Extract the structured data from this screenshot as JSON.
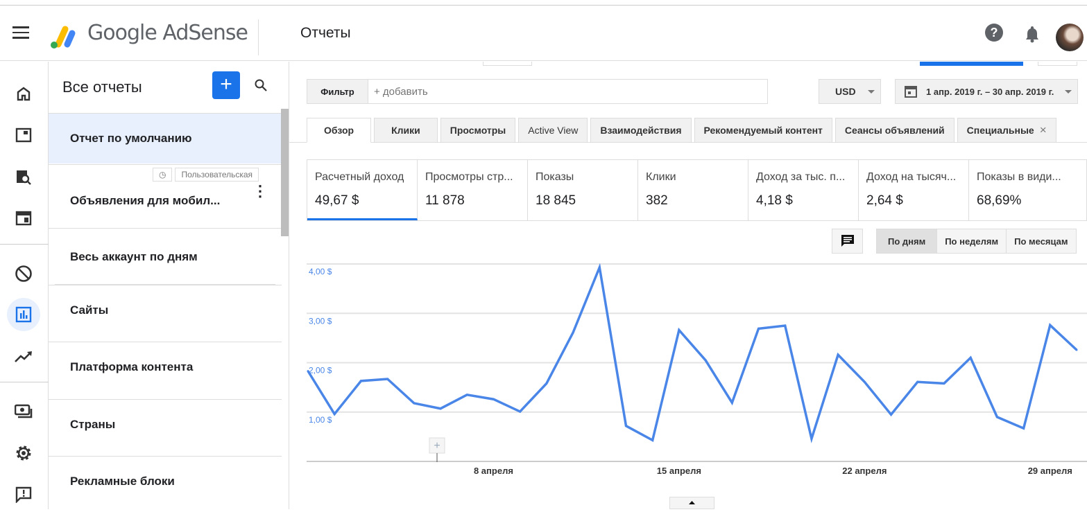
{
  "header": {
    "brand": "Google AdSense",
    "title": "Отчеты",
    "help_icon": "?"
  },
  "leftnav": {
    "items": [
      "home",
      "ads",
      "page-preview",
      "ad-units",
      "block-controls",
      "reports",
      "optimization",
      "payments",
      "settings",
      "feedback"
    ],
    "active": "reports"
  },
  "reports_panel": {
    "title": "Все отчеты",
    "add_label": "+",
    "items": [
      {
        "label": "Отчет по умолчанию",
        "selected": true
      },
      {
        "label": "Объявления для мобил...",
        "tag": "Пользовательская"
      },
      {
        "label": "Весь аккаунт по дням"
      },
      {
        "label": "Сайты"
      },
      {
        "label": "Платформа контента"
      },
      {
        "label": "Страны"
      },
      {
        "label": "Рекламные блоки"
      }
    ]
  },
  "toolbar": {
    "filter_label": "Фильтр",
    "filter_placeholder": "+ добавить",
    "currency": "USD",
    "date_range": "1 апр. 2019 г. – 30 апр. 2019 г."
  },
  "tabs": [
    {
      "label": "Обзор",
      "active": true
    },
    {
      "label": "Клики"
    },
    {
      "label": "Просмотры"
    },
    {
      "label": "Active View"
    },
    {
      "label": "Взаимодействия"
    },
    {
      "label": "Рекомендуемый контент"
    },
    {
      "label": "Сеансы объявлений"
    },
    {
      "label": "Специальные",
      "closable": true,
      "close": "×"
    }
  ],
  "metrics": [
    {
      "name": "Расчетный доход",
      "value": "49,67 $",
      "selected": true
    },
    {
      "name": "Просмотры стр...",
      "value": "11 878"
    },
    {
      "name": "Показы",
      "value": "18 845"
    },
    {
      "name": "Клики",
      "value": "382"
    },
    {
      "name": "Доход за тыс. п...",
      "value": "4,18 $"
    },
    {
      "name": "Доход на тысяч...",
      "value": "2,64 $"
    },
    {
      "name": "Показы в види...",
      "value": "68,69%"
    }
  ],
  "period": {
    "options": [
      "По дням",
      "По неделям",
      "По месяцам"
    ],
    "active": "По дням"
  },
  "colors": {
    "accent": "#1a73e8",
    "line": "#4a86e8"
  },
  "chart_data": {
    "type": "line",
    "title": "",
    "xlabel": "",
    "ylabel": "",
    "x": [
      "1 апреля",
      "2 апреля",
      "3 апреля",
      "4 апреля",
      "5 апреля",
      "6 апреля",
      "7 апреля",
      "8 апреля",
      "9 апреля",
      "10 апреля",
      "11 апреля",
      "12 апреля",
      "13 апреля",
      "14 апреля",
      "15 апреля",
      "16 апреля",
      "17 апреля",
      "18 апреля",
      "19 апреля",
      "20 апреля",
      "21 апреля",
      "22 апреля",
      "23 апреля",
      "24 апреля",
      "25 апреля",
      "26 апреля",
      "27 апреля",
      "28 апреля",
      "29 апреля",
      "30 апреля"
    ],
    "series": [
      {
        "values": [
          1.83,
          0.96,
          1.63,
          1.67,
          1.18,
          1.07,
          1.35,
          1.26,
          1.01,
          1.58,
          2.61,
          3.93,
          0.72,
          0.43,
          2.66,
          2.05,
          1.19,
          2.69,
          2.75,
          0.46,
          2.16,
          1.61,
          0.95,
          1.61,
          1.58,
          2.1,
          0.9,
          0.67,
          2.76,
          2.26
        ]
      }
    ],
    "ylim": [
      0,
      4
    ],
    "yticks": [
      "1,00 $",
      "2,00 $",
      "3,00 $",
      "4,00 $"
    ],
    "xticks": [
      {
        "label": "8 апреля",
        "index": 7
      },
      {
        "label": "15 апреля",
        "index": 14
      },
      {
        "label": "22 апреля",
        "index": 21
      },
      {
        "label": "29 апреля",
        "index": 28
      }
    ],
    "grid": true
  }
}
